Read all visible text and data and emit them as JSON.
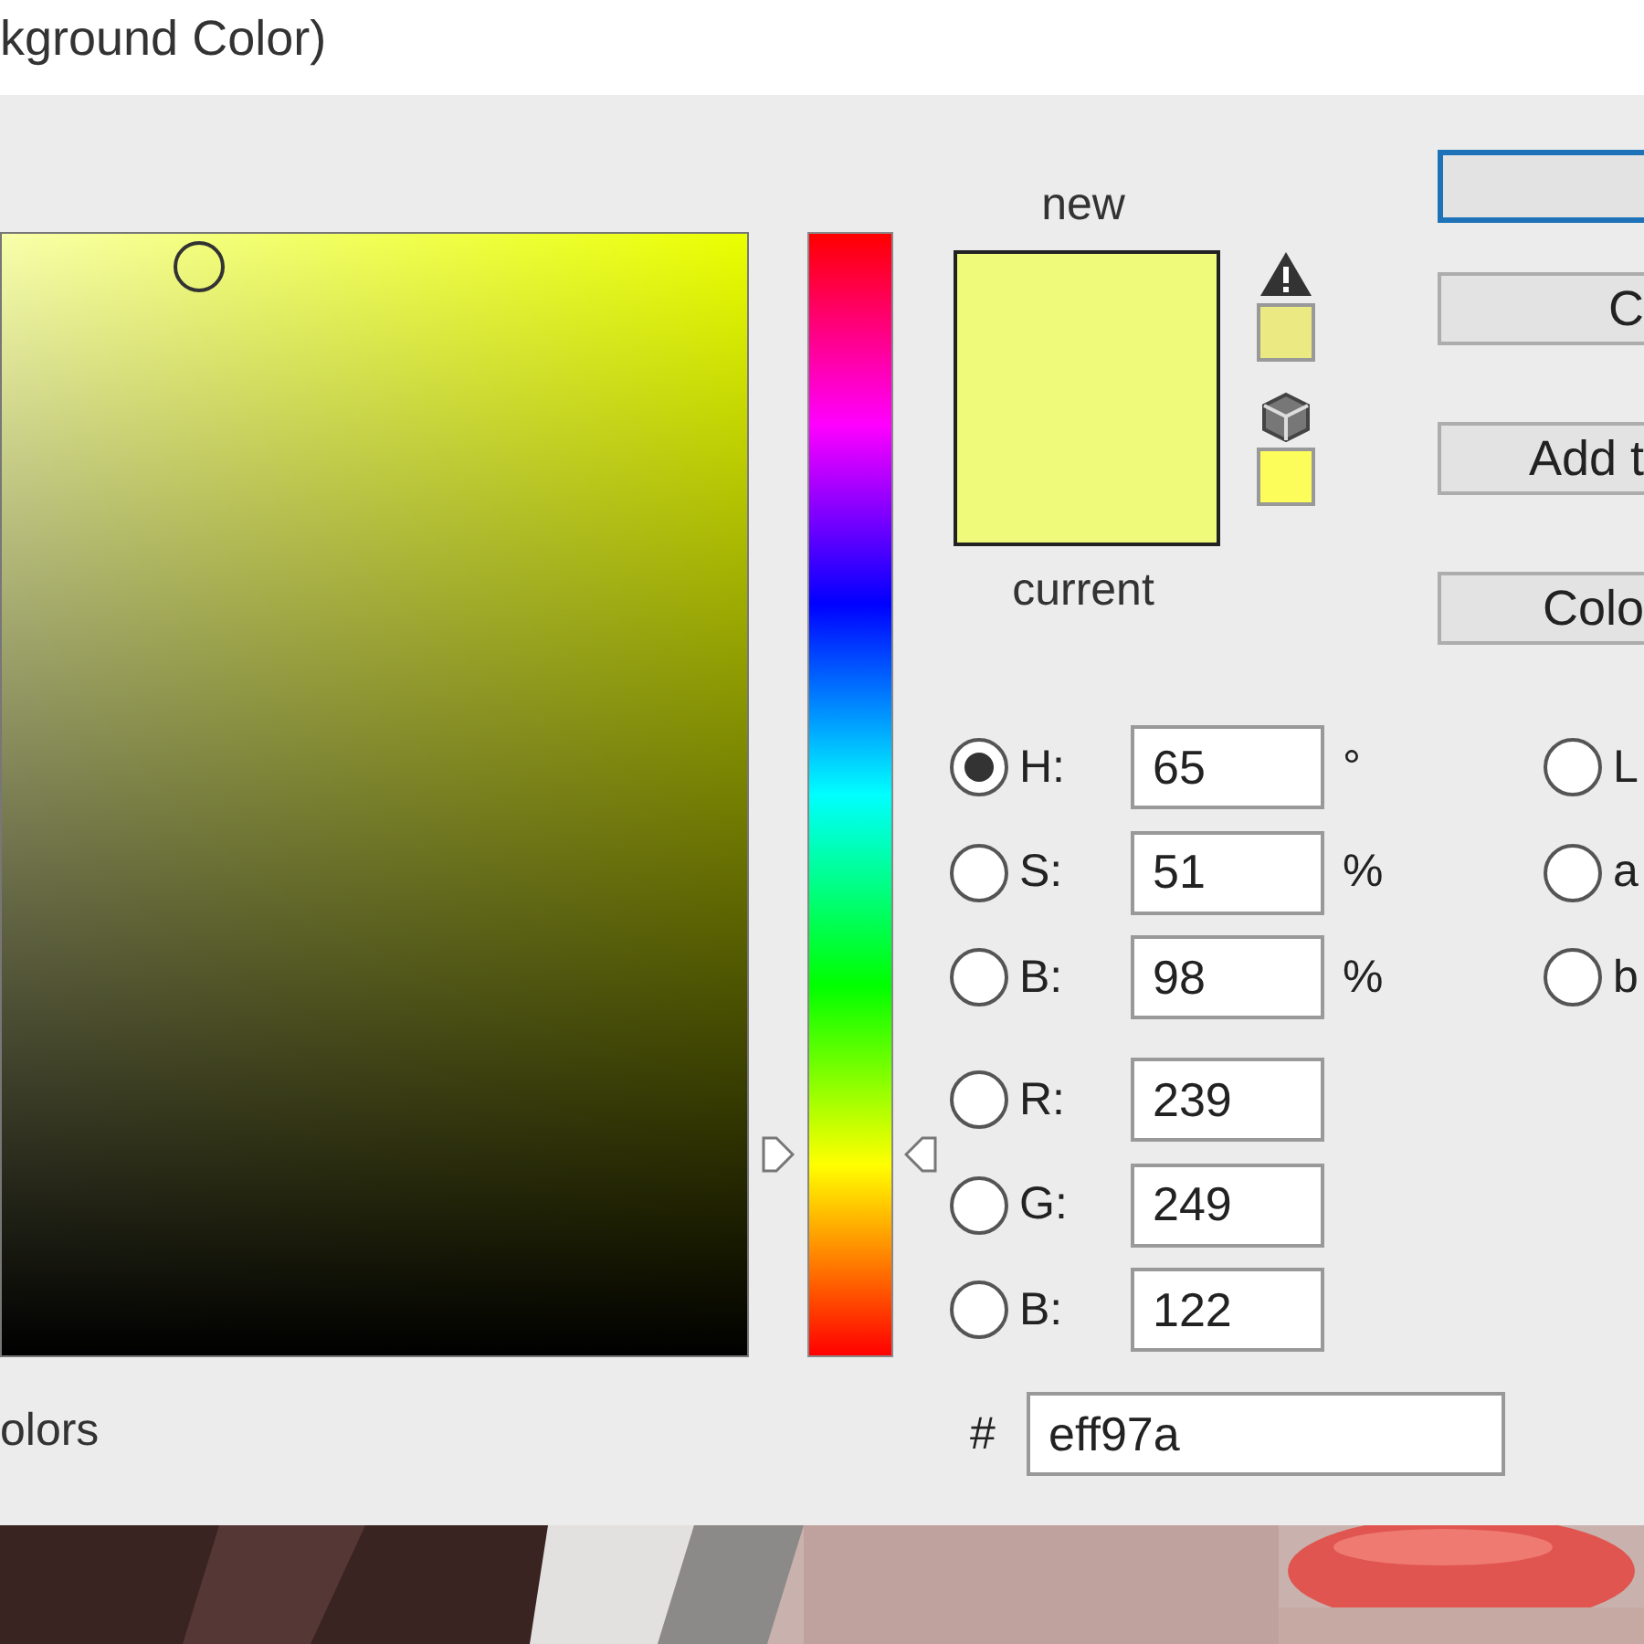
{
  "window": {
    "title": "kground Color)"
  },
  "hue_slider": {
    "level": 0.18
  },
  "only_web_colors": {
    "label": "olors"
  },
  "preview": {
    "new_label": "new",
    "current_label": "current"
  },
  "alerts": [
    {
      "kind": "warning"
    },
    {
      "kind": "web"
    }
  ],
  "buttons": [
    {
      "default": true
    },
    {
      "label": "C",
      "default": false
    },
    {
      "label": "Add t",
      "default": false
    },
    {
      "label": "Colo",
      "default": false
    }
  ],
  "hsb_fields": [
    {
      "label": "H:",
      "value": "65",
      "unit": "°",
      "selected": true
    },
    {
      "label": "S:",
      "value": "51",
      "unit": "%",
      "selected": false
    },
    {
      "label": "B:",
      "value": "98",
      "unit": "%",
      "selected": false
    }
  ],
  "rgb_fields": [
    {
      "label": "R:",
      "value": "239",
      "selected": false
    },
    {
      "label": "G:",
      "value": "249",
      "selected": false
    },
    {
      "label": "B:",
      "value": "122",
      "selected": false
    }
  ],
  "lab_fields": [
    {
      "label": "L",
      "selected": false
    },
    {
      "label": "a",
      "selected": false
    },
    {
      "label": "b",
      "selected": false
    }
  ],
  "hex": {
    "label": "#",
    "value": "eff97a"
  }
}
